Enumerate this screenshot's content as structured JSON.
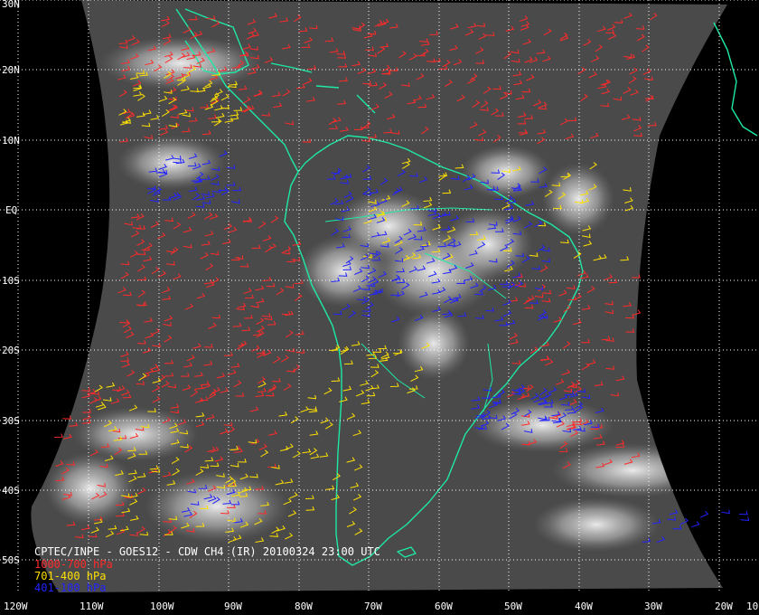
{
  "colors": {
    "background": "#000000",
    "coastline": "#1ee8a6",
    "grid": "#ffffff",
    "low_level": "#ff2a2a",
    "mid_level": "#ffe100",
    "high_level": "#2222ff"
  },
  "latitude_labels": [
    "30N",
    "20N",
    "10N",
    "EQ",
    "10S",
    "20S",
    "30S",
    "40S",
    "50S"
  ],
  "longitude_labels": [
    "120W",
    "110W",
    "100W",
    "90W",
    "80W",
    "70W",
    "60W",
    "50W",
    "40W",
    "30W",
    "20W",
    "10"
  ],
  "caption": {
    "title": "CPTEC/INPE - GOES12 - CDW CH4 (IR) 20100324 23:00 UTC",
    "low_level": "1000-700 hPa",
    "mid_level": "701-400 hPa",
    "high_level": "401-100 hPa"
  }
}
